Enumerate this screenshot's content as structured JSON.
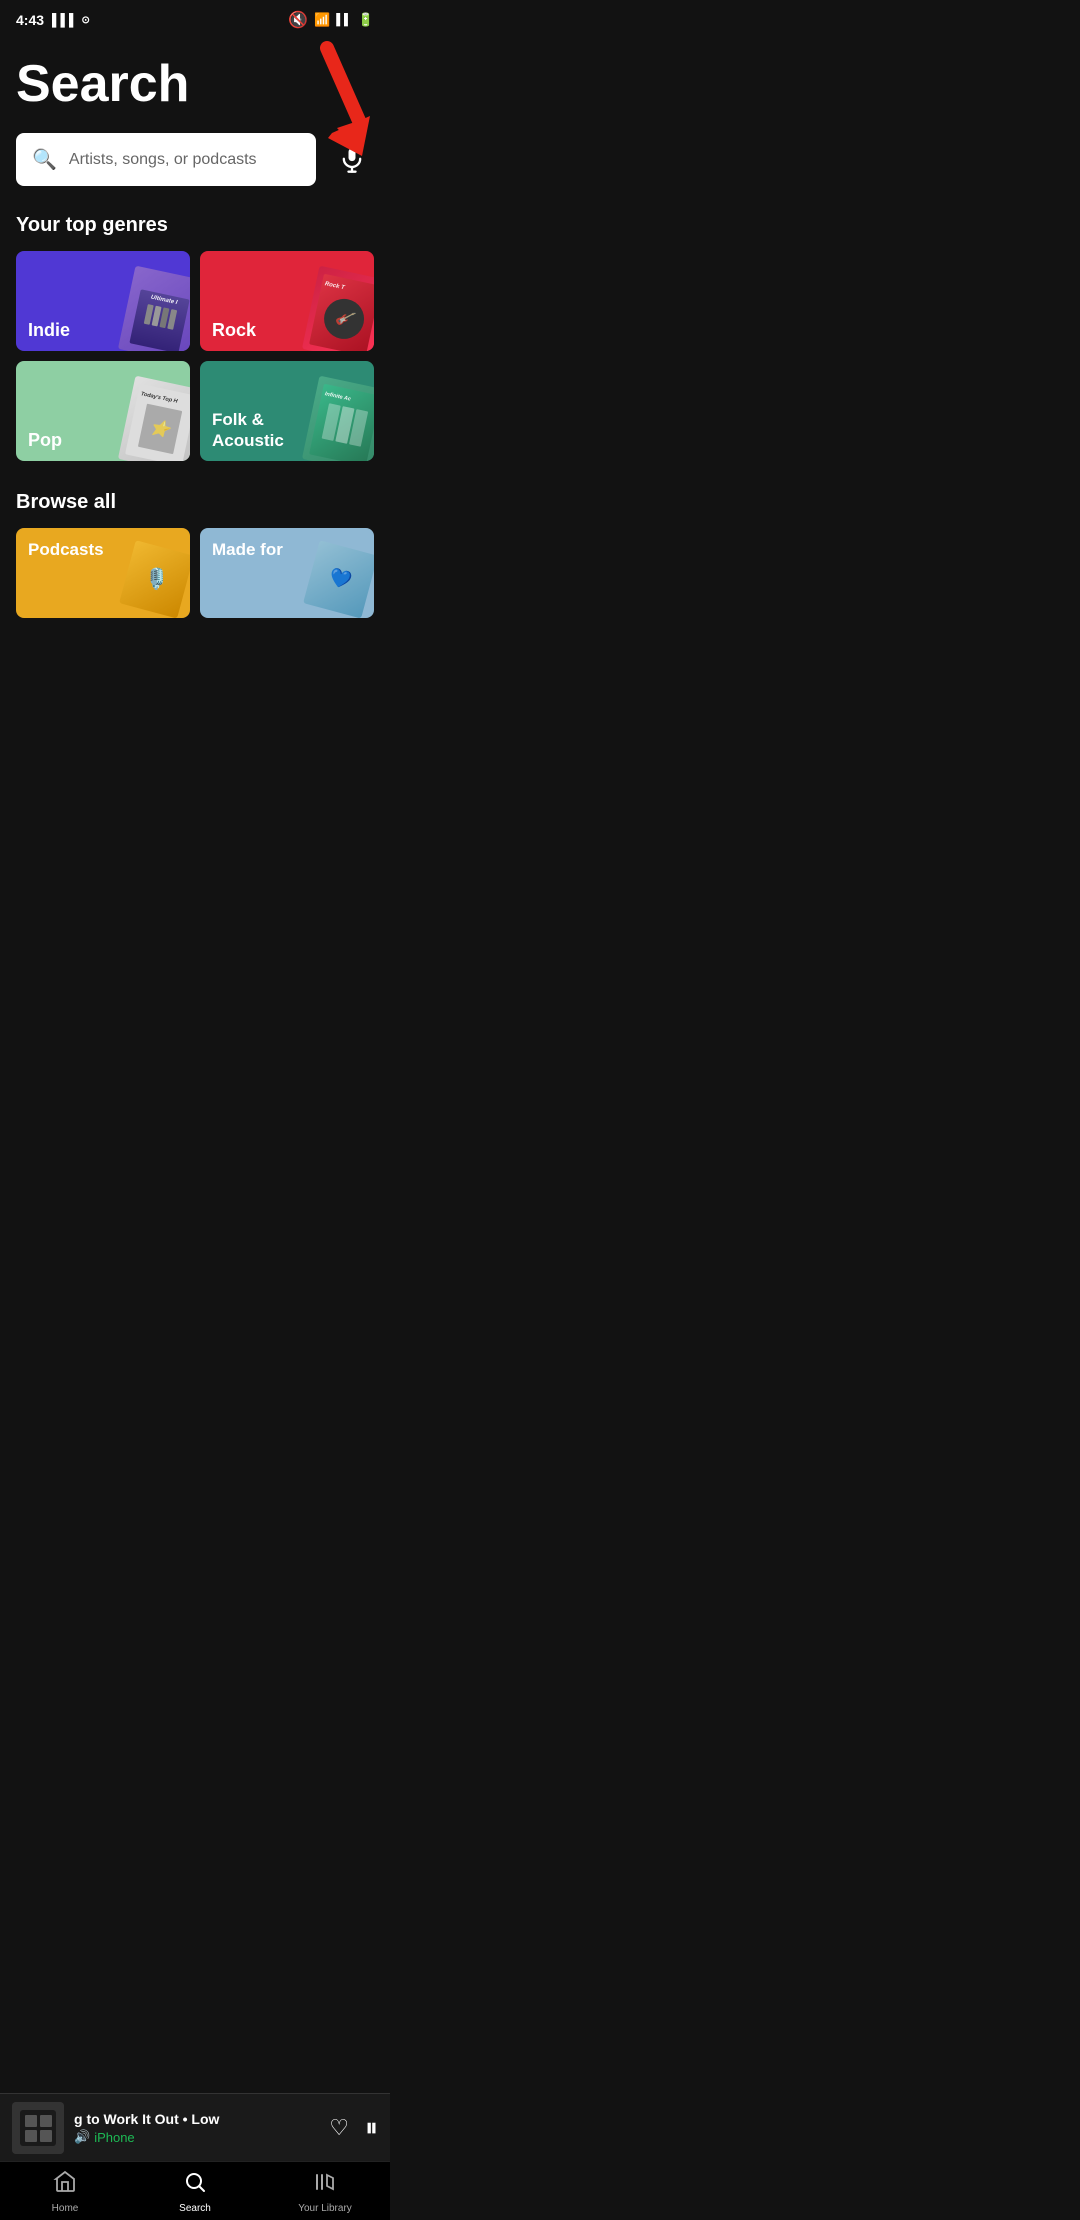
{
  "statusBar": {
    "time": "4:43",
    "icons": [
      "signal",
      "data-icon",
      "notification",
      "mute",
      "wifi",
      "signal2",
      "battery"
    ]
  },
  "page": {
    "title": "Search"
  },
  "searchBar": {
    "placeholder": "Artists, songs, or podcasts"
  },
  "topGenres": {
    "heading": "Your top genres",
    "items": [
      {
        "label": "Indie",
        "color": "#5038d4",
        "artText": "Ultimate I"
      },
      {
        "label": "Rock",
        "color": "#e0253a",
        "artText": "Rock T"
      },
      {
        "label": "Pop",
        "color": "#8ecfa3",
        "artText": "Today's Top H"
      },
      {
        "label": "Folk &\nAcoustic",
        "color": "#2d9e7a",
        "artText": "Infinite Ac"
      }
    ]
  },
  "browseAll": {
    "heading": "Browse all",
    "items": [
      {
        "label": "Podcasts",
        "color": "#e8a820"
      },
      {
        "label": "Made for",
        "color": "#7aaec8"
      }
    ]
  },
  "nowPlaying": {
    "trackName": "g to Work It Out • Low",
    "device": "iPhone",
    "albumArt": "🎵"
  },
  "bottomNav": {
    "items": [
      {
        "label": "Home",
        "active": false
      },
      {
        "label": "Search",
        "active": true
      },
      {
        "label": "Your Library",
        "active": false
      }
    ]
  }
}
